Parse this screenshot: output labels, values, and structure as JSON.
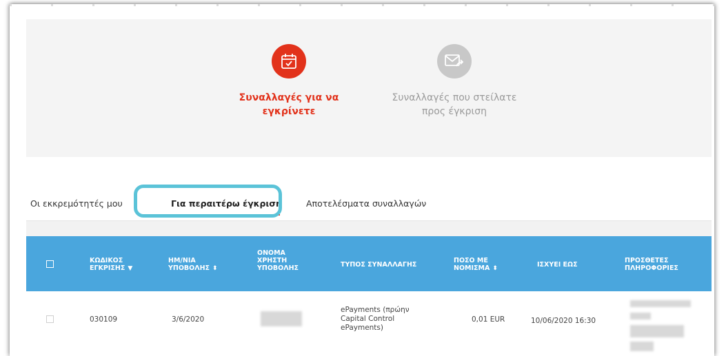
{
  "hero": {
    "items": [
      {
        "label_line1": "Συναλλαγές για να",
        "label_line2": "εγκρίνετε",
        "icon": "calendar-check-icon",
        "state": "active"
      },
      {
        "label_line1": "Συναλλαγές που στείλατε",
        "label_line2": "προς έγκριση",
        "icon": "envelope-send-icon",
        "state": "inactive"
      }
    ]
  },
  "tabs": [
    {
      "label": "Οι εκκρεμότητές μου",
      "active": false
    },
    {
      "label": "Για περαιτέρω έγκριση",
      "active": true
    },
    {
      "label": "Αποτελέσματα συναλλαγών",
      "active": false
    }
  ],
  "table": {
    "columns": [
      {
        "l1": "ΚΩΔΙΚΟΣ",
        "l2": "ΕΓΚΡΙΣΗΣ",
        "l3": "",
        "l4": "",
        "sort": "▼"
      },
      {
        "l1": "ΗΜ/ΝΙΑ",
        "l2": "ΥΠΟΒΟΛΗΣ",
        "l3": "",
        "l4": "",
        "sort": "⬍"
      },
      {
        "l1": "ΟΝΟΜΑ",
        "l2": "ΧΡΗΣΤΗ",
        "l3": "ΥΠΟΒΟΛΗΣ",
        "l4": "",
        "sort": ""
      },
      {
        "l1": "ΤΥΠΟΣ ΣΥΝΑΛΛΑΓΗΣ",
        "l2": "",
        "l3": "",
        "l4": "",
        "sort": ""
      },
      {
        "l1": "ΠΟΣΟ ΜΕ",
        "l2": "ΝΟΜΙΣΜΑ",
        "l3": "",
        "l4": "",
        "sort": "⬍"
      },
      {
        "l1": "ΙΣΧΥΕΙ ΕΩΣ",
        "l2": "",
        "l3": "",
        "l4": "",
        "sort": ""
      },
      {
        "l1": "ΠΡΟΣΘΕΤΕΣ",
        "l2": "ΠΛΗΡΟΦΟΡΙΕΣ",
        "l3": "",
        "l4": "",
        "sort": ""
      }
    ],
    "rows": [
      {
        "code": "030109",
        "date": "3/6/2020",
        "type_l1": "ePayments (πρώην",
        "type_l2": "Capital Control",
        "type_l3": "ePayments)",
        "amount": "0,01 EUR",
        "valid_until": "10/06/2020 16:30"
      }
    ]
  },
  "colors": {
    "accent": "#e2321b",
    "header_blue": "#4aa6dd",
    "highlight": "#5bc3d8"
  }
}
